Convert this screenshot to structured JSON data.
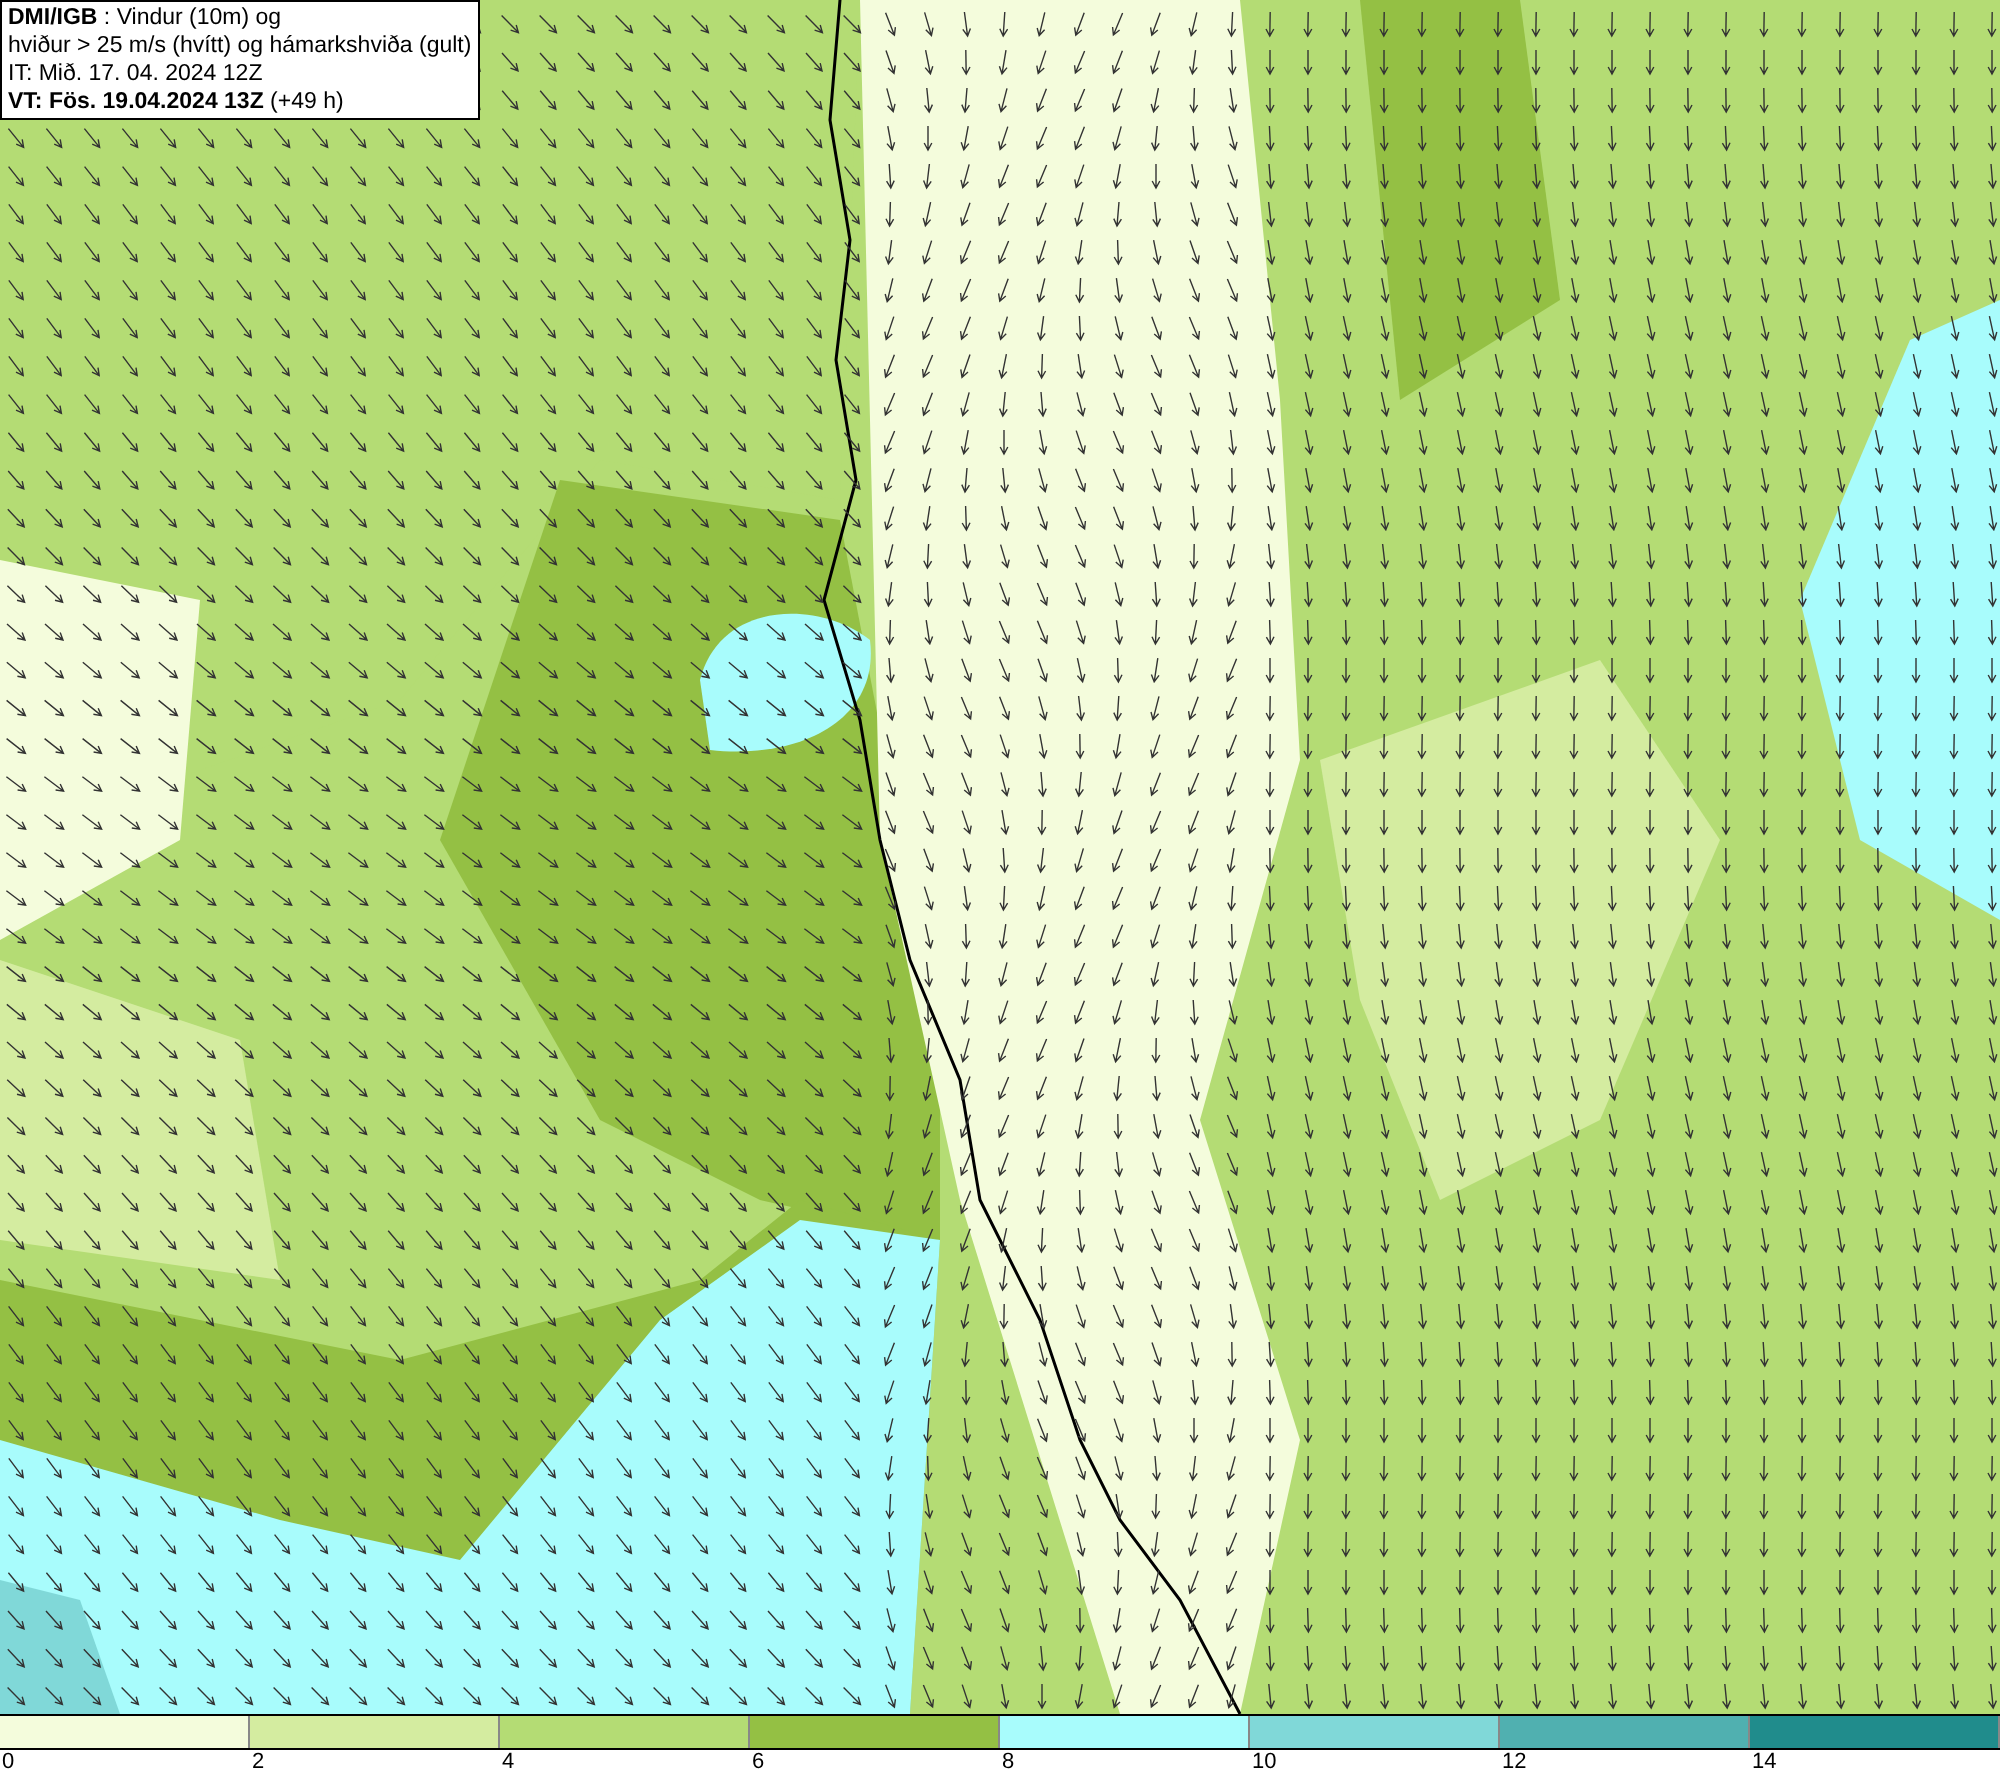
{
  "header": {
    "lines": [
      "**DMI/IGB** : Vindur (10m) og",
      "hviður > 25 m/s (hvítt) og hámarkshviða (gult)",
      "IT: Mið. 17. 04. 2024 12Z",
      "**VT: Fös. 19.04.2024 13Z** (+49 h)"
    ]
  },
  "legend": {
    "swatches": [
      {
        "color": "#f4fcdc"
      },
      {
        "color": "#d4eca0"
      },
      {
        "color": "#b4dc74"
      },
      {
        "color": "#94c044"
      },
      {
        "color": "#a8fcfc"
      },
      {
        "color": "#80d8d8"
      },
      {
        "color": "#50b0b0"
      },
      {
        "color": "#208c8c"
      }
    ],
    "labels": [
      "0",
      "2",
      "4",
      "6",
      "8",
      "10",
      "12",
      "14"
    ]
  }
}
